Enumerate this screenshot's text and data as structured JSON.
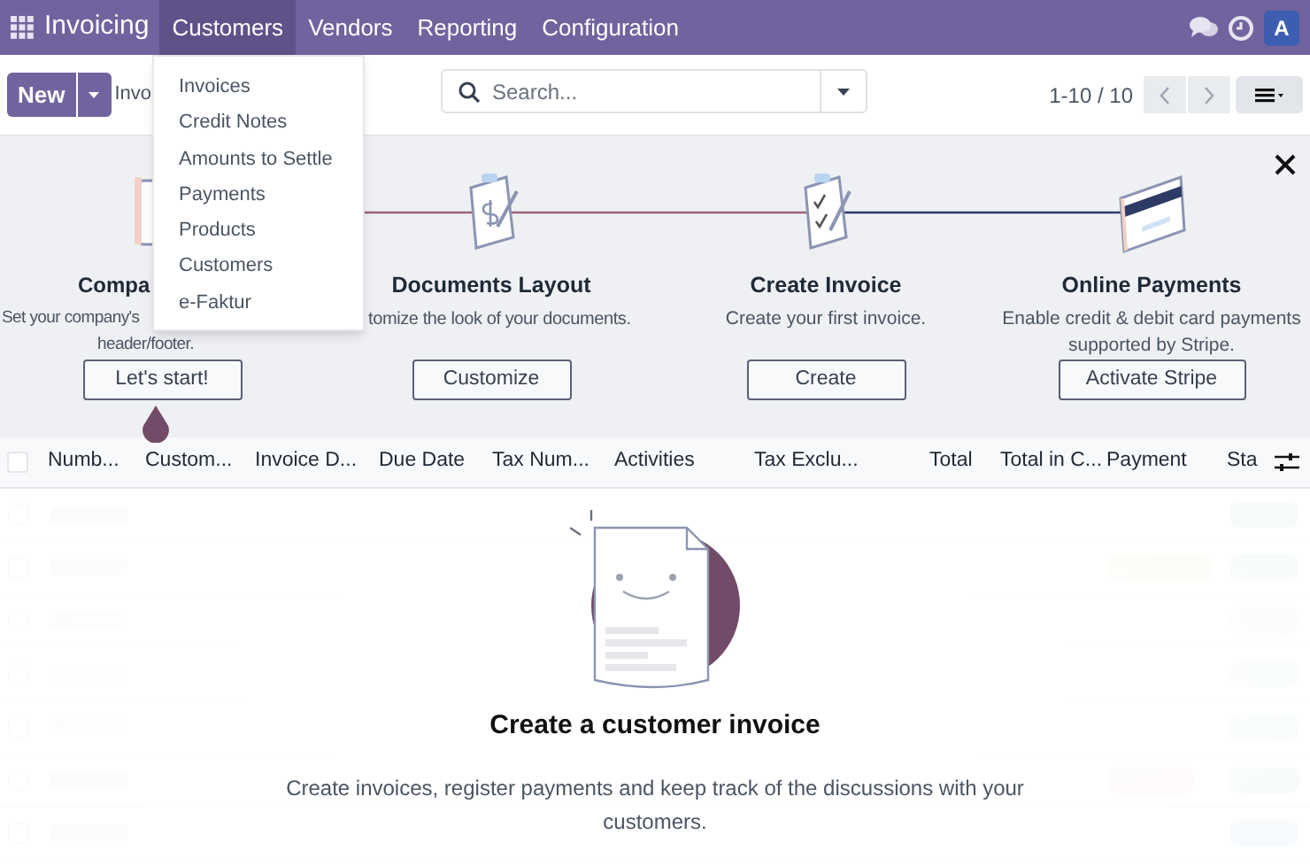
{
  "navbar": {
    "app": "Invoicing",
    "menus": [
      {
        "label": "Customers",
        "selected": true
      },
      {
        "label": "Vendors",
        "selected": false
      },
      {
        "label": "Reporting",
        "selected": false
      },
      {
        "label": "Configuration",
        "selected": false
      }
    ],
    "avatar": "A"
  },
  "dropdown": [
    "Invoices",
    "Credit Notes",
    "Amounts to Settle",
    "Payments",
    "Products",
    "Customers",
    "e-Faktur"
  ],
  "control_bar": {
    "new_button": "New",
    "breadcrumb": "Invo",
    "search": {
      "placeholder": "Search..."
    },
    "pager": "1-10 / 10"
  },
  "onboarding": {
    "steps": [
      {
        "kind": "company",
        "title": "Compa",
        "description": [
          "Set your company's",
          "header/footer."
        ],
        "button": "Let's start!",
        "current": true
      },
      {
        "kind": "layout",
        "title": "Documents Layout",
        "description": [
          "tomize the look of your documents."
        ],
        "button": "Customize",
        "current": false
      },
      {
        "kind": "invoice",
        "title": "Create Invoice",
        "description": [
          "Create your first invoice."
        ],
        "button": "Create",
        "current": false
      },
      {
        "kind": "payment",
        "title": "Online Payments",
        "description": [
          "Enable credit & debit card payments",
          "supported by Stripe."
        ],
        "button": "Activate Stripe",
        "current": false
      }
    ]
  },
  "table": {
    "select_all_checked": false,
    "columns": [
      "Numb...",
      "Custom...",
      "Invoice D...",
      "Due Date",
      "Tax Num...",
      "Activities",
      "Tax Exclu...",
      "Total",
      "Total in C...",
      "Payment",
      "Sta"
    ]
  },
  "empty_state": {
    "title": "Create a customer invoice",
    "text": "Create invoices, register payments and keep track of the discussions with your customers."
  }
}
